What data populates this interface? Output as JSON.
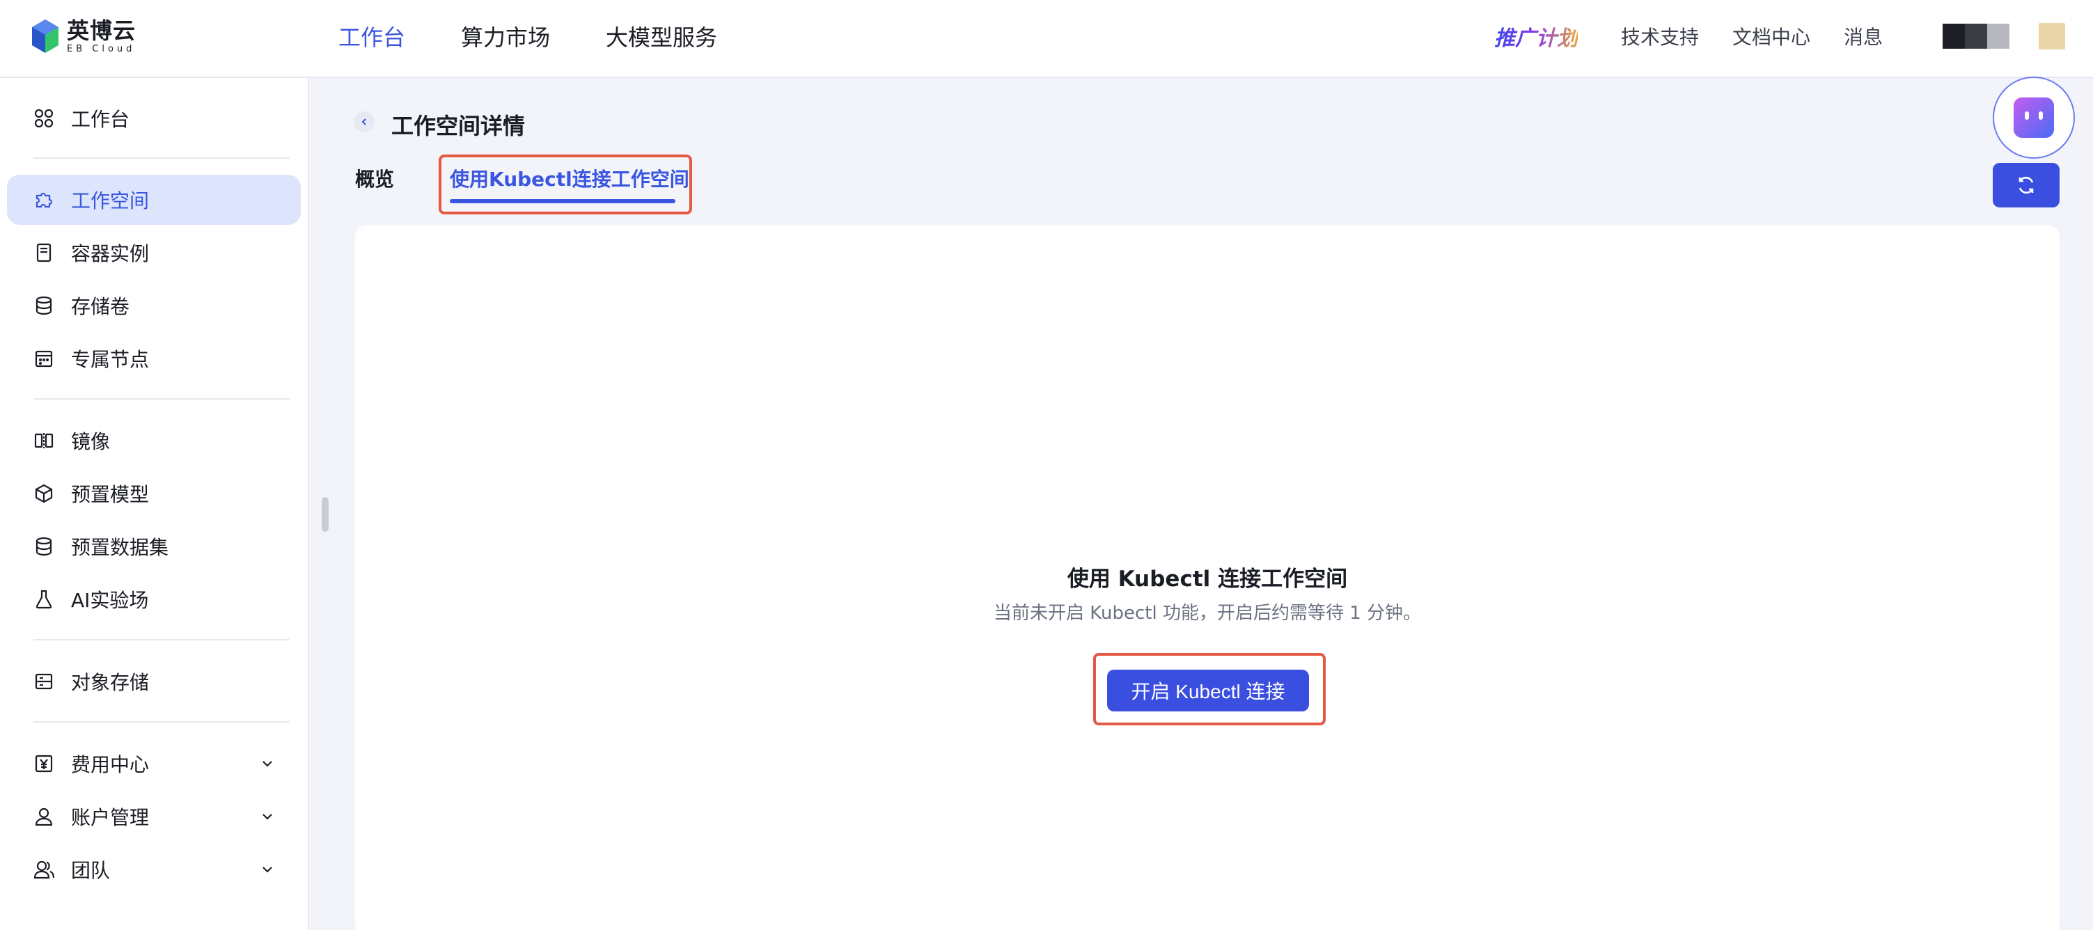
{
  "brand": {
    "name_cn": "英博云",
    "name_en": "EB Cloud"
  },
  "topnav": [
    {
      "label": "工作台",
      "active": true
    },
    {
      "label": "算力市场",
      "active": false
    },
    {
      "label": "大模型服务",
      "active": false
    }
  ],
  "topright": {
    "promo": "推广计划",
    "links": [
      "技术支持",
      "文档中心",
      "消息"
    ]
  },
  "sidebar": {
    "items": [
      {
        "label": "工作台",
        "icon": "dashboard-icon"
      },
      {
        "label": "工作空间",
        "icon": "puzzle-icon",
        "active": true
      },
      {
        "label": "容器实例",
        "icon": "container-icon"
      },
      {
        "label": "存储卷",
        "icon": "database-icon"
      },
      {
        "label": "专属节点",
        "icon": "calendar-grid-icon"
      },
      {
        "label": "镜像",
        "icon": "mirror-icon"
      },
      {
        "label": "预置模型",
        "icon": "cube-icon"
      },
      {
        "label": "预置数据集",
        "icon": "database-icon"
      },
      {
        "label": "AI实验场",
        "icon": "flask-icon"
      },
      {
        "label": "对象存储",
        "icon": "storage-card-icon"
      },
      {
        "label": "费用中心",
        "icon": "yen-icon",
        "expandable": true
      },
      {
        "label": "账户管理",
        "icon": "user-icon",
        "expandable": true
      },
      {
        "label": "团队",
        "icon": "team-icon",
        "expandable": true
      }
    ]
  },
  "page": {
    "title": "工作空间详情",
    "tabs": [
      {
        "label": "概览",
        "active": false
      },
      {
        "label": "使用Kubectl连接工作空间",
        "active": true
      }
    ]
  },
  "empty_state": {
    "title": "使用 Kubectl 连接工作空间",
    "description": "当前未开启 Kubectl 功能，开启后约需等待 1 分钟。",
    "button_label": "开启 Kubectl 连接"
  },
  "colors": {
    "accent": "#3a55e0",
    "highlight": "#e45844",
    "active_bg": "#dce5fb",
    "background": "#f2f4f9"
  }
}
